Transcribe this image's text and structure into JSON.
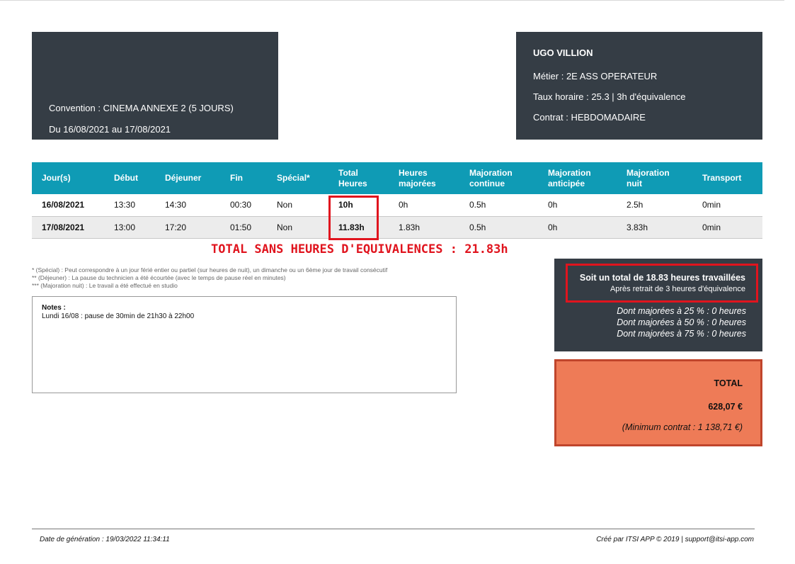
{
  "convention": {
    "line1": "Convention : CINEMA ANNEXE 2 (5 JOURS)",
    "line2": "Du 16/08/2021 au 17/08/2021"
  },
  "employee": {
    "name": "UGO VILLION",
    "metier": "Métier : 2E ASS OPERATEUR",
    "taux": "Taux horaire : 25.3 | 3h d'équivalence",
    "contrat": "Contrat : HEBDOMADAIRE"
  },
  "table": {
    "headers": [
      {
        "l1": "Jour(s)",
        "l2": ""
      },
      {
        "l1": "Début",
        "l2": ""
      },
      {
        "l1": "Déjeuner",
        "l2": ""
      },
      {
        "l1": "Fin",
        "l2": ""
      },
      {
        "l1": "Spécial*",
        "l2": ""
      },
      {
        "l1": "Total",
        "l2": "Heures"
      },
      {
        "l1": "Heures",
        "l2": "majorées"
      },
      {
        "l1": "Majoration",
        "l2": "continue"
      },
      {
        "l1": "Majoration",
        "l2": "anticipée"
      },
      {
        "l1": "Majoration",
        "l2": "nuit"
      },
      {
        "l1": "Transport",
        "l2": ""
      }
    ],
    "rows": [
      [
        "16/08/2021",
        "13:30",
        "14:30",
        "00:30",
        "Non",
        "10h",
        "0h",
        "0.5h",
        "0h",
        "2.5h",
        "0min"
      ],
      [
        "17/08/2021",
        "13:00",
        "17:20",
        "01:50",
        "Non",
        "11.83h",
        "1.83h",
        "0.5h",
        "0h",
        "3.83h",
        "0min"
      ]
    ]
  },
  "total_sans": "TOTAL SANS HEURES D'EQUIVALENCES : 21.83h",
  "footnotes": [
    "* (Spécial) : Peut correspondre à un jour férié entier ou partiel (sur heures de nuit), un dimanche ou un 6ème jour de travail consécutif",
    "** (Déjeuner) : La pause du technicien a été écourtée (avec le temps de pause réel en minutes)",
    "*** (Majoration nuit) : Le travail a été effectué en studio"
  ],
  "notes": {
    "title": "Notes :",
    "text": "Lundi 16/08 : pause de 30min de 21h30 à 22h00"
  },
  "summary": {
    "main": "Soit un total de 18.83 heures travaillées",
    "sub": "Après retrait de 3 heures d'équivalence",
    "maj25": "Dont majorées à 25 % : 0 heures",
    "maj50": "Dont majorées à 50 % : 0 heures",
    "maj75": "Dont majorées à 75 % : 0 heures"
  },
  "total": {
    "label": "TOTAL",
    "amount": "628,07 €",
    "minimum": "(Minimum contrat : 1 138,71 €)"
  },
  "footer": {
    "left": "Date de génération : 19/03/2022 11:34:11",
    "right": "Créé par ITSI APP © 2019 | support@itsi-app.com"
  },
  "colors": {
    "dark_panel": "#353d45",
    "table_header": "#0f9bb5",
    "highlight_red": "#e0141e",
    "total_orange": "#ee7b57"
  }
}
